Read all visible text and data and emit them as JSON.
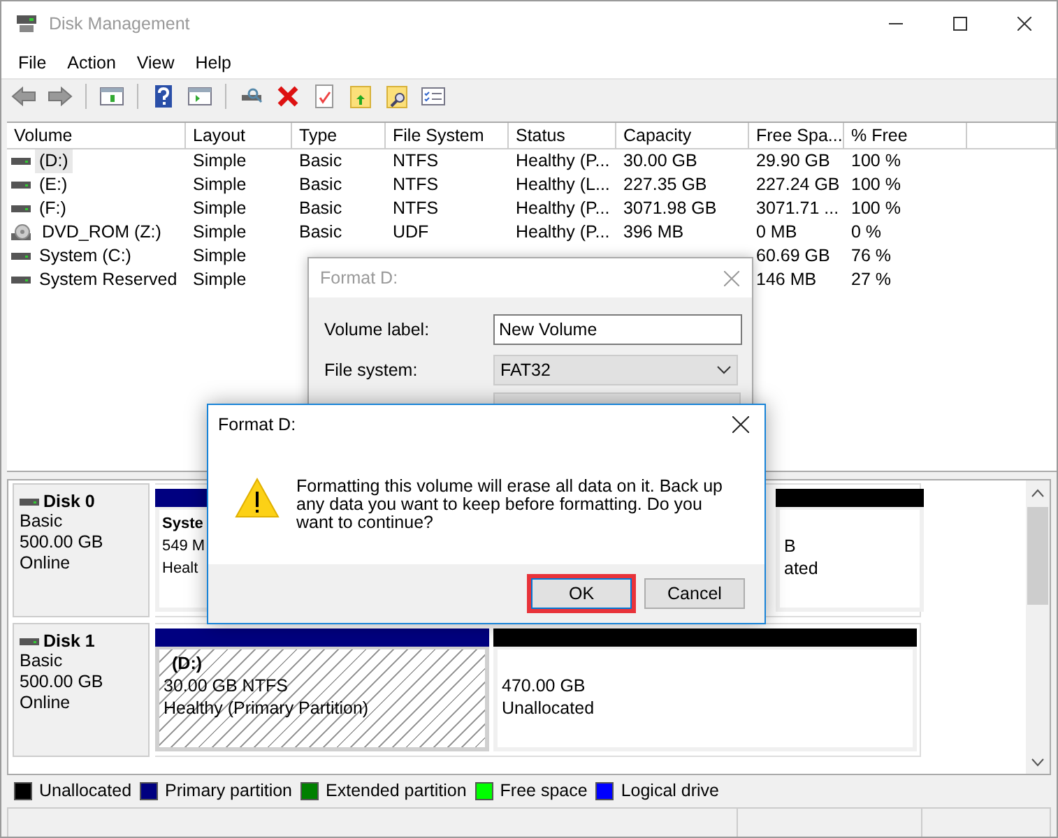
{
  "window": {
    "title": "Disk Management"
  },
  "menu": [
    "File",
    "Action",
    "View",
    "Help"
  ],
  "volume_list": {
    "columns": [
      "Volume",
      "Layout",
      "Type",
      "File System",
      "Status",
      "Capacity",
      "Free Spa...",
      "% Free"
    ],
    "rows": [
      {
        "kind": "disk",
        "selected": true,
        "volume": "(D:)",
        "layout": "Simple",
        "type": "Basic",
        "file_system": "NTFS",
        "status": "Healthy (P...",
        "capacity": "30.00 GB",
        "free_space": "29.90 GB",
        "percent_free": "100 %"
      },
      {
        "kind": "disk",
        "selected": false,
        "volume": "(E:)",
        "layout": "Simple",
        "type": "Basic",
        "file_system": "NTFS",
        "status": "Healthy (L...",
        "capacity": "227.35 GB",
        "free_space": "227.24 GB",
        "percent_free": "100 %"
      },
      {
        "kind": "disk",
        "selected": false,
        "volume": "(F:)",
        "layout": "Simple",
        "type": "Basic",
        "file_system": "NTFS",
        "status": "Healthy (P...",
        "capacity": "3071.98 GB",
        "free_space": "3071.71 ...",
        "percent_free": "100 %"
      },
      {
        "kind": "dvd",
        "selected": false,
        "volume": "DVD_ROM (Z:)",
        "layout": "Simple",
        "type": "Basic",
        "file_system": "UDF",
        "status": "Healthy (P...",
        "capacity": "396 MB",
        "free_space": "0 MB",
        "percent_free": "0 %"
      },
      {
        "kind": "disk",
        "selected": false,
        "volume": "System (C:)",
        "layout": "Simple",
        "free_space": "60.69 GB",
        "percent_free": "76 %"
      },
      {
        "kind": "disk",
        "selected": false,
        "volume": "System Reserved",
        "layout": "Simple",
        "free_space": "146 MB",
        "percent_free": "27 %"
      }
    ]
  },
  "disks": [
    {
      "name": "Disk 0",
      "type": "Basic",
      "size": "500.00 GB",
      "status": "Online",
      "partitions": [
        {
          "kind": "primary",
          "selected": false,
          "title": "Syste",
          "size": "549 M",
          "status": "Healt"
        },
        {
          "kind": "unallocated",
          "selected": false,
          "size": "B",
          "status": "ated"
        }
      ]
    },
    {
      "name": "Disk 1",
      "type": "Basic",
      "size": "500.00 GB",
      "status": "Online",
      "partitions": [
        {
          "kind": "primary",
          "selected": true,
          "title": "(D:)",
          "size": "30.00 GB NTFS",
          "status": "Healthy (Primary Partition)"
        },
        {
          "kind": "unallocated",
          "selected": false,
          "size": "470.00 GB",
          "status": "Unallocated"
        }
      ]
    }
  ],
  "legend": [
    {
      "label": "Unallocated",
      "color": "#000000"
    },
    {
      "label": "Primary partition",
      "color": "#000080"
    },
    {
      "label": "Extended partition",
      "color": "#008000"
    },
    {
      "label": "Free space",
      "color": "#00ff00"
    },
    {
      "label": "Logical drive",
      "color": "#0000ff"
    }
  ],
  "format_dialog": {
    "title": "Format D:",
    "fields": [
      {
        "label": "Volume label:",
        "kind": "text",
        "value": "New Volume"
      },
      {
        "label": "File system:",
        "kind": "select",
        "value": "FAT32"
      }
    ]
  },
  "confirm_dialog": {
    "title": "Format D:",
    "message": "Formatting this volume will erase all data on it. Back up any data you want to keep before formatting. Do you want to continue?",
    "buttons": [
      {
        "label": "OK",
        "focused": true
      },
      {
        "label": "Cancel",
        "focused": false
      }
    ]
  }
}
